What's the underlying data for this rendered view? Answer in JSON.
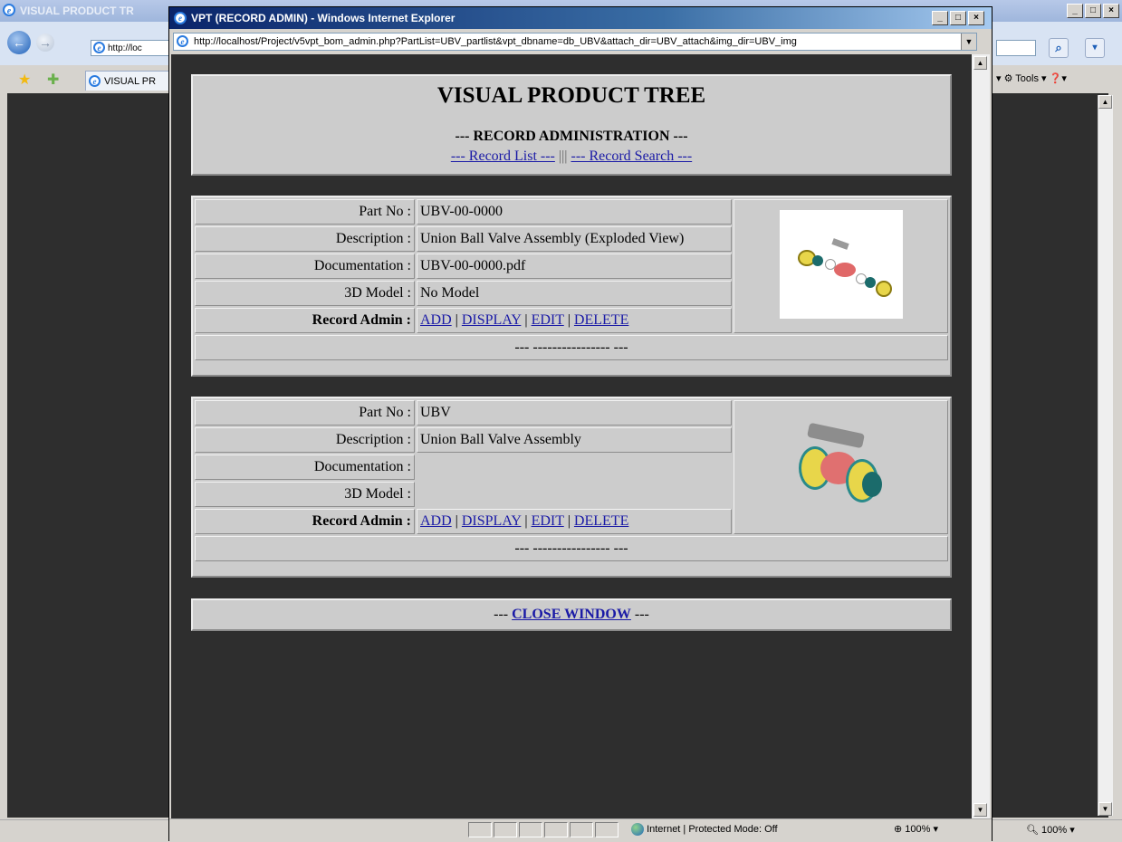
{
  "background_window": {
    "title": "VISUAL PRODUCT TR",
    "address": "http://loc",
    "tab_label": "VISUAL PR",
    "tools_label": "Tools",
    "zoom": "100%"
  },
  "popup": {
    "title": "VPT (RECORD ADMIN) - Windows Internet Explorer",
    "url": "http://localhost/Project/v5vpt_bom_admin.php?PartList=UBV_partlist&vpt_dbname=db_UBV&attach_dir=UBV_attach&img_dir=UBV_img",
    "status": {
      "zone": "Internet | Protected Mode: Off",
      "zoom": "100%"
    }
  },
  "page": {
    "title": "VISUAL PRODUCT TREE",
    "subtitle": "--- RECORD ADMINISTRATION ---",
    "link_list": "--- Record List ---",
    "link_sep": "|||",
    "link_search": "--- Record Search ---",
    "labels": {
      "part_no": "Part No :",
      "description": "Description :",
      "documentation": "Documentation :",
      "model": "3D Model :",
      "record_admin": "Record Admin :"
    },
    "actions": {
      "add": "ADD",
      "display": "DISPLAY",
      "edit": "EDIT",
      "delete": "DELETE",
      "sep": "|"
    },
    "records": [
      {
        "part_no": "UBV-00-0000",
        "description": "Union Ball Valve Assembly (Exploded View)",
        "documentation": "UBV-00-0000.pdf",
        "model": "No Model",
        "footer": "--- ---------------- ---"
      },
      {
        "part_no": "UBV",
        "description": "Union Ball Valve Assembly",
        "documentation": "",
        "model": "",
        "footer": "--- ---------------- ---"
      }
    ],
    "close_prefix": "---",
    "close_label": "CLOSE WINDOW",
    "close_suffix": "---"
  }
}
